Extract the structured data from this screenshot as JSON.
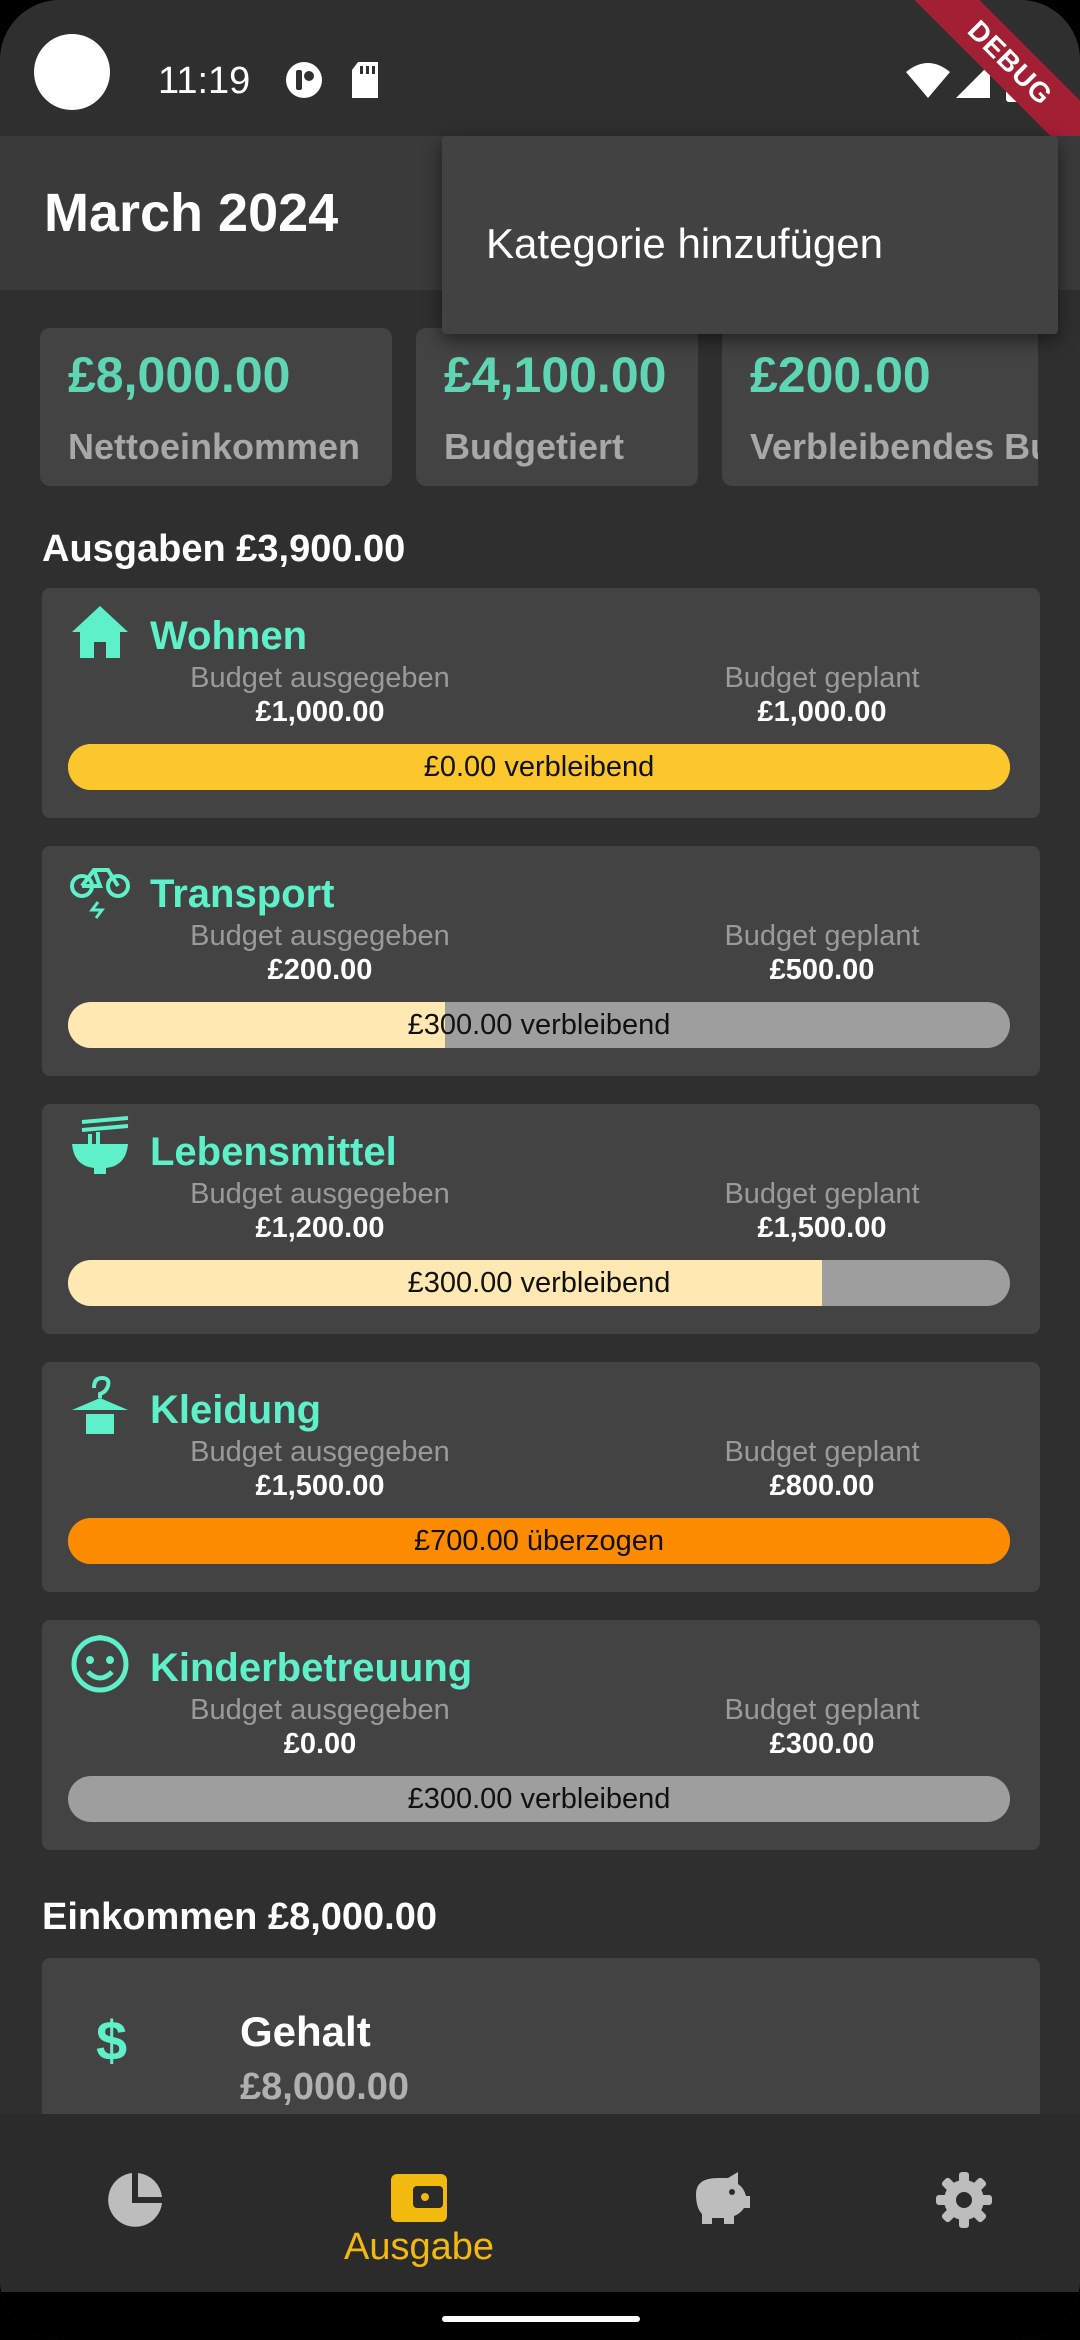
{
  "status_bar": {
    "time": "11:19",
    "debug_label": "DEBUG"
  },
  "app_bar": {
    "title": "March 2024"
  },
  "menu": {
    "add_category": "Kategorie hinzufügen"
  },
  "summary": [
    {
      "amount": "£8,000.00",
      "label": "Nettoeinkommen"
    },
    {
      "amount": "£4,100.00",
      "label": "Budgetiert"
    },
    {
      "amount": "£200.00",
      "label": "Verbleibendes Bu"
    }
  ],
  "expenses_header": "Ausgaben £3,900.00",
  "labels": {
    "spent": "Budget ausgegeben",
    "planned": "Budget geplant"
  },
  "categories": [
    {
      "name": "Wohnen",
      "icon": "home-icon",
      "spent": "£1,000.00",
      "planned": "£1,000.00",
      "status": "£0.00 verbleibend",
      "fill_percent": 100,
      "fill_color": "#fcc62d",
      "track_color": "#9e9e9e"
    },
    {
      "name": "Transport",
      "icon": "bike-icon",
      "spent": "£200.00",
      "planned": "£500.00",
      "status": "£300.00 verbleibend",
      "fill_percent": 40,
      "fill_color": "#ffe8b2",
      "track_color": "#9e9e9e"
    },
    {
      "name": "Lebensmittel",
      "icon": "noodle-bowl-icon",
      "spent": "£1,200.00",
      "planned": "£1,500.00",
      "status": "£300.00 verbleibend",
      "fill_percent": 80,
      "fill_color": "#ffe8b2",
      "track_color": "#9e9e9e"
    },
    {
      "name": "Kleidung",
      "icon": "dry-cleaning-icon",
      "spent": "£1,500.00",
      "planned": "£800.00",
      "status": "£700.00 überzogen",
      "fill_percent": 100,
      "fill_color": "#fd8b00",
      "track_color": "#9e9e9e"
    },
    {
      "name": "Kinderbetreuung",
      "icon": "child-face-icon",
      "spent": "£0.00",
      "planned": "£300.00",
      "status": "£300.00 verbleibend",
      "fill_percent": 0,
      "fill_color": "#ffe8b2",
      "track_color": "#9e9e9e"
    }
  ],
  "income_header": "Einkommen £8,000.00",
  "income": {
    "name": "Gehalt",
    "amount": "£8,000.00",
    "icon": "dollar-icon"
  },
  "nav": {
    "items": [
      {
        "icon": "pie-chart-icon",
        "label": ""
      },
      {
        "icon": "wallet-icon",
        "label": "Ausgabe",
        "active": true
      },
      {
        "icon": "piggy-bank-icon",
        "label": ""
      },
      {
        "icon": "settings-icon",
        "label": ""
      }
    ],
    "active_color": "#f2b90f",
    "inactive_color": "#bdbdbd"
  },
  "colors": {
    "accent": "#5ef0c8",
    "amount_teal": "#5fd6b2",
    "card": "#434343",
    "background": "#2f2f2f"
  }
}
